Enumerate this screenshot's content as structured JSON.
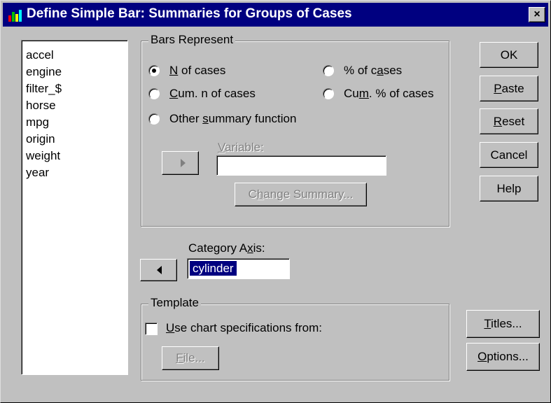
{
  "window": {
    "title": "Define Simple Bar: Summaries for Groups of Cases",
    "close_glyph": "×"
  },
  "variables": [
    "accel",
    "engine",
    "filter_$",
    "horse",
    "mpg",
    "origin",
    "weight",
    "year"
  ],
  "bars_represent": {
    "legend": "Bars Represent",
    "n_of_cases": {
      "pre": "",
      "u": "N",
      "post": " of cases"
    },
    "pct_of_cases": {
      "pre": "% of c",
      "u": "a",
      "post": "ses"
    },
    "cum_n": {
      "pre": "",
      "u": "C",
      "post": "um. n of cases"
    },
    "cum_pct": {
      "pre": "Cu",
      "u": "m",
      "post": ". % of cases"
    },
    "other": {
      "pre": "Other ",
      "u": "s",
      "post": "ummary function"
    },
    "variable_label": {
      "pre": "",
      "u": "V",
      "post": "ariable:"
    },
    "variable_value": "",
    "change_summary": {
      "pre": "C",
      "u": "h",
      "post": "ange Summary..."
    },
    "selected": "n_of_cases"
  },
  "category_axis": {
    "pre": "Category A",
    "u": "x",
    "post": "is:",
    "value": "cylinder"
  },
  "template": {
    "legend": "Template",
    "use_chart": {
      "pre": "",
      "u": "U",
      "post": "se chart specifications from:"
    },
    "file": {
      "pre": "",
      "u": "F",
      "post": "ile..."
    },
    "checked": false
  },
  "buttons": {
    "ok": "OK",
    "paste": {
      "u": "P",
      "post": "aste"
    },
    "reset": {
      "u": "R",
      "post": "eset"
    },
    "cancel": "Cancel",
    "help": "Help",
    "titles": {
      "u": "T",
      "post": "itles..."
    },
    "options": {
      "u": "O",
      "post": "ptions..."
    }
  },
  "colors": {
    "titlebar": "#000080",
    "face": "#c0c0c0",
    "selection": "#000080"
  }
}
